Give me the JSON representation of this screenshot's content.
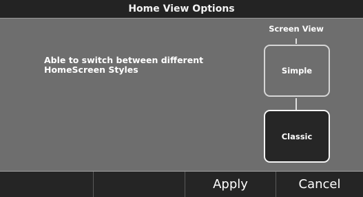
{
  "header": {
    "title": "Home View Options"
  },
  "main": {
    "description": "Able to switch between different HomeScreen Styles",
    "section_label": "Screen View",
    "options": [
      {
        "label": "Simple",
        "selected": false
      },
      {
        "label": "Classic",
        "selected": true
      }
    ]
  },
  "footer": {
    "buttons": [
      {
        "label": ""
      },
      {
        "label": ""
      },
      {
        "label": "Apply"
      },
      {
        "label": "Cancel"
      }
    ]
  },
  "colors": {
    "background": "#6e6e6e",
    "bar": "#232323",
    "selected_option": "#262626",
    "text": "#ffffff"
  }
}
